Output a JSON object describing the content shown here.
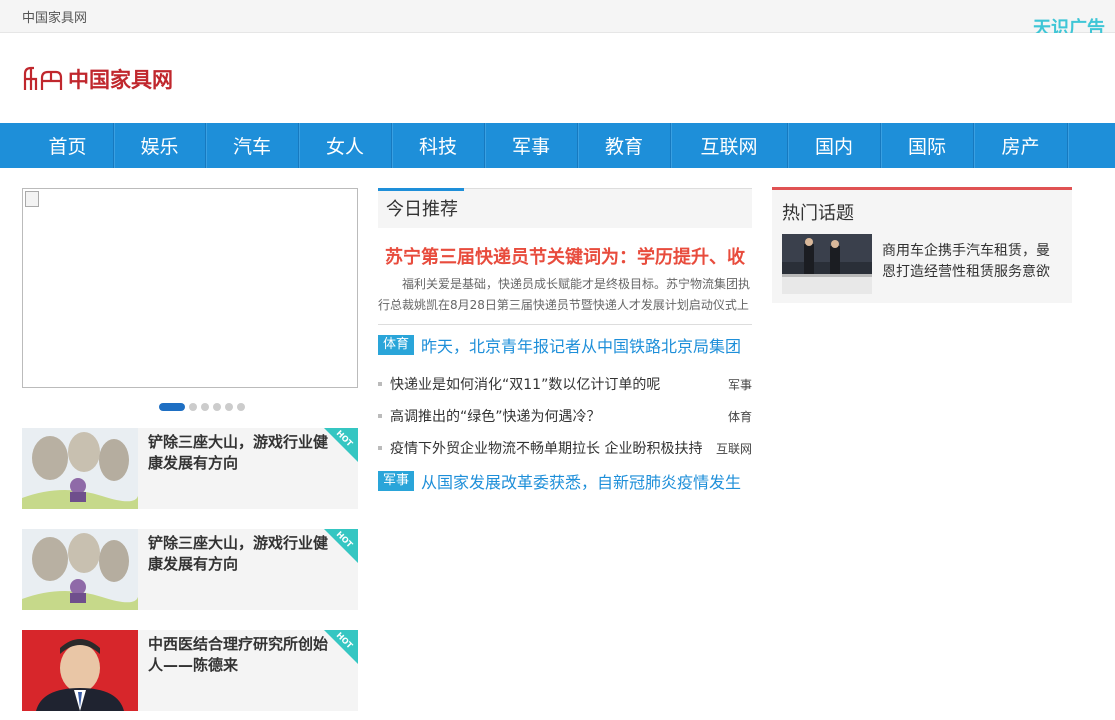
{
  "topbar": {
    "site_name": "中国家具网",
    "ad_label": "天识广告"
  },
  "header": {
    "logo_text": "中国家具网"
  },
  "nav": {
    "items": [
      "首页",
      "娱乐",
      "汽车",
      "女人",
      "科技",
      "军事",
      "教育",
      "互联网",
      "国内",
      "国际",
      "房产"
    ]
  },
  "slider": {
    "dots": 6,
    "active": 0
  },
  "hot_list": [
    {
      "title": "铲除三座大山，游戏行业健康发展有方向",
      "badge": "HOT"
    },
    {
      "title": "铲除三座大山，游戏行业健康发展有方向",
      "badge": "HOT"
    },
    {
      "title": "中西医结合理疗研究所创始人——陈德来",
      "badge": "HOT"
    }
  ],
  "middle": {
    "tab_label": "今日推荐",
    "feature_title": "苏宁第三届快递员节关键词为：学历提升、收",
    "feature_desc": "福利关爱是基础，快递员成长赋能才是终极目标。苏宁物流集团执行总裁姚凯在8月28日第三届快递员节暨快递人才发展计划启动仪式上",
    "tag_news_1": {
      "tag": "体育",
      "text": "昨天，北京青年报记者从中国铁路北京局集团"
    },
    "list": [
      {
        "title": "快递业是如何消化“双11”数以亿计订单的呢",
        "category": "军事"
      },
      {
        "title": "高调推出的“绿色”快递为何遇冷？",
        "category": "体育"
      },
      {
        "title": "疫情下外贸企业物流不畅单期拉长 企业盼积极扶持",
        "category": "互联网"
      }
    ],
    "tag_news_2": {
      "tag": "军事",
      "text": "从国家发展改革委获悉，自新冠肺炎疫情发生"
    }
  },
  "right": {
    "topics_label": "热门话题",
    "topic_desc": "商用车企携手汽车租赁，曼恩打造经营性租赁服务意欲"
  }
}
